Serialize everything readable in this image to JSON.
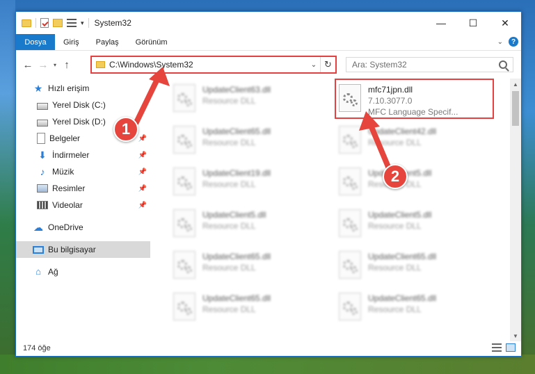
{
  "window": {
    "title": "System32",
    "controls": {
      "minimize": "—",
      "maximize": "☐",
      "close": "✕"
    }
  },
  "ribbon": {
    "tabs": [
      "Dosya",
      "Giriş",
      "Paylaş",
      "Görünüm"
    ],
    "help": "?"
  },
  "address": {
    "path": "C:\\Windows\\System32",
    "search_placeholder": "Ara: System32"
  },
  "nav": {
    "items": [
      {
        "label": "Hızlı erişim",
        "icon": "star-icon"
      },
      {
        "label": "Yerel Disk (C:)",
        "icon": "drive-icon"
      },
      {
        "label": "Yerel Disk (D:)",
        "icon": "drive-icon"
      },
      {
        "label": "Belgeler",
        "icon": "documents-icon"
      },
      {
        "label": "İndirmeler",
        "icon": "downloads-icon"
      },
      {
        "label": "Müzik",
        "icon": "music-icon"
      },
      {
        "label": "Resimler",
        "icon": "pictures-icon"
      },
      {
        "label": "Videolar",
        "icon": "videos-icon"
      },
      {
        "label": "OneDrive",
        "icon": "cloud-icon"
      },
      {
        "label": "Bu bilgisayar",
        "icon": "computer-icon"
      },
      {
        "label": "Ağ",
        "icon": "network-icon"
      }
    ]
  },
  "files": {
    "highlighted": {
      "name": "mfc71jpn.dll",
      "version": "7.10.3077.0",
      "description": "MFC Language Specif..."
    },
    "left_column": [
      {
        "name": "UpdateClient63.dll",
        "type": "Resource DLL"
      },
      {
        "name": "UpdateClient65.dll",
        "type": "Resource DLL"
      },
      {
        "name": "UpdateClient19.dll",
        "type": "Resource DLL"
      },
      {
        "name": "UpdateClient5.dll",
        "type": "Resource DLL"
      },
      {
        "name": "UpdateClient65.dll",
        "type": "Resource DLL"
      },
      {
        "name": "UpdateClient65.dll",
        "type": "Resource DLL"
      }
    ],
    "right_column": [
      {
        "name": "UpdateClient42.dll",
        "type": "Resource DLL"
      },
      {
        "name": "UpdateClient5.dll",
        "type": "Resource DLL"
      },
      {
        "name": "UpdateClient5.dll",
        "type": "Resource DLL"
      },
      {
        "name": "UpdateClient65.dll",
        "type": "Resource DLL"
      },
      {
        "name": "UpdateClient65.dll",
        "type": "Resource DLL"
      }
    ]
  },
  "status": {
    "item_count": "174 öğe"
  },
  "annotations": {
    "callout1": "1",
    "callout2": "2",
    "color": "#e5453c"
  }
}
